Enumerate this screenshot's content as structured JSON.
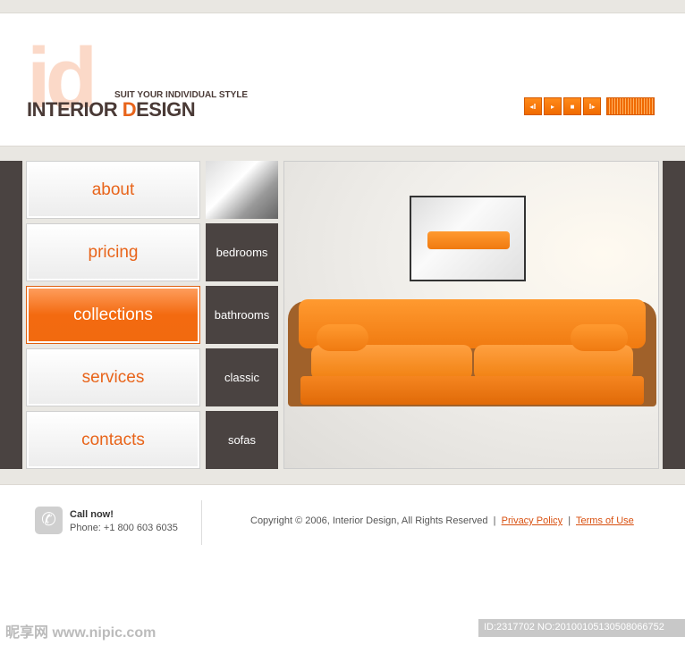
{
  "header": {
    "logo_mark": "id",
    "tagline": "SUIT YOUR INDIVIDUAL STYLE",
    "brand_part1": "INTERIOR ",
    "brand_d": "D",
    "brand_part2": "ESIGN"
  },
  "player": {
    "controls": [
      "previous-icon",
      "play-icon",
      "stop-icon",
      "next-icon"
    ],
    "equalizer": "equalizer-icon"
  },
  "nav": {
    "items": [
      {
        "label": "about"
      },
      {
        "label": "pricing"
      },
      {
        "label": "collections",
        "active": true
      },
      {
        "label": "services"
      },
      {
        "label": "contacts"
      }
    ]
  },
  "collections": {
    "items": [
      {
        "label": "bedrooms"
      },
      {
        "label": "bathrooms"
      },
      {
        "label": "classic"
      },
      {
        "label": "sofas"
      }
    ]
  },
  "footer": {
    "call_title": "Call now!",
    "phone": "Phone:  +1 800 603 6035",
    "copyright": "Copyright © 2006, Interior Design, All Rights Reserved",
    "sep": "|",
    "privacy": "Privacy Policy",
    "terms": "Terms of Use"
  },
  "watermark": {
    "site": "昵享网 www.nipic.com",
    "id": "ID:2317702 NO:20100105130508066752"
  },
  "colors": {
    "accent": "#f26a0f",
    "dark": "#4a4341",
    "band": "#e9e7e2"
  }
}
